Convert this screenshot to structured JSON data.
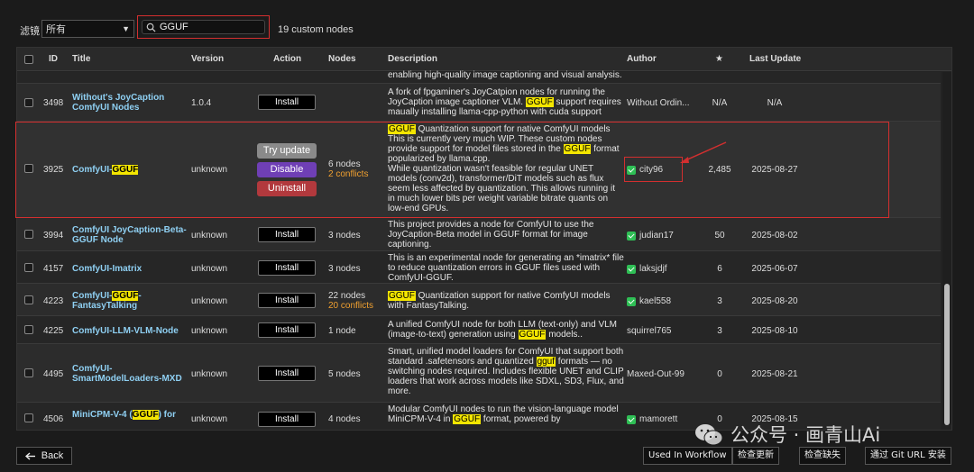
{
  "filter": {
    "label": "滤镜",
    "selected": "所有"
  },
  "search": {
    "value": "GGUF"
  },
  "count_text": "19 custom nodes",
  "columns": {
    "id": "ID",
    "title": "Title",
    "version": "Version",
    "action": "Action",
    "nodes": "Nodes",
    "description": "Description",
    "author": "Author",
    "stars": "★",
    "last_update": "Last Update"
  },
  "partial_top_desc": "enabling high-quality image captioning and visual analysis.",
  "rows": [
    {
      "id": "3498",
      "title": "Without's JoyCaption ComfyUI Nodes",
      "version": "1.0.4",
      "action": "Install",
      "desc_a": "A fork of fpgaminer's JoyCatpion nodes for running the JoyCaption image captioner VLM. ",
      "desc_hl": "GGUF",
      "desc_b": " support requires maually installing llama-cpp-python with cuda support",
      "author": "Without Ordin...",
      "stars": "N/A",
      "update": "N/A"
    },
    {
      "id": "3925",
      "title_a": "ComfyUI-",
      "title_hl": "GGUF",
      "version": "unknown",
      "actions": {
        "try_update": "Try update",
        "disable": "Disable",
        "uninstall": "Uninstall"
      },
      "nodes": "6 nodes",
      "conflicts": "2 conflicts",
      "desc_hl1": "GGUF",
      "desc_a": " Quantization support for native ComfyUI models This is currently very much WIP. These custom nodes provide support for model files stored in the ",
      "desc_hl2": "GGUF",
      "desc_b": " format popularized by llama.cpp.",
      "desc_c": "While quantization wasn't feasible for regular UNET models (conv2d), transformer/DiT models such as flux seem less affected by quantization. This allows running it in much lower bits per weight variable bitrate quants on low-end GPUs.",
      "author": "city96",
      "stars": "2,485",
      "update": "2025-08-27"
    },
    {
      "id": "3994",
      "title": "ComfyUI JoyCaption-Beta-GGUF Node",
      "version": "unknown",
      "action": "Install",
      "nodes": "3 nodes",
      "desc": "This project provides a node for ComfyUI to use the JoyCaption-Beta model in GGUF format for image captioning.",
      "author": "judian17",
      "stars": "50",
      "update": "2025-08-02"
    },
    {
      "id": "4157",
      "title": "ComfyUI-Imatrix",
      "version": "unknown",
      "action": "Install",
      "nodes": "3 nodes",
      "desc": "This is an experimental node for generating an *imatrix* file to reduce quantization errors in GGUF files used with ComfyUI-GGUF.",
      "author": "laksjdjf",
      "stars": "6",
      "update": "2025-06-07"
    },
    {
      "id": "4223",
      "title_a": "ComfyUI-",
      "title_hl": "GGUF",
      "title_b": "-FantasyTalking",
      "version": "unknown",
      "action": "Install",
      "nodes": "22 nodes",
      "conflicts": "20 conflicts",
      "desc_hl": "GGUF",
      "desc_b": " Quantization support for native ComfyUI models with FantasyTalking.",
      "author": "kael558",
      "stars": "3",
      "update": "2025-08-20"
    },
    {
      "id": "4225",
      "title": "ComfyUI-LLM-VLM-Node",
      "version": "unknown",
      "action": "Install",
      "nodes": "1 node",
      "desc_a": "A unified ComfyUI node for both LLM (text-only) and VLM (image-to-text) generation using ",
      "desc_hl": "GGUF",
      "desc_b": " models..",
      "author": "squirrel765",
      "stars": "3",
      "update": "2025-08-10"
    },
    {
      "id": "4495",
      "title": "ComfyUI-SmartModelLoaders-MXD",
      "version": "unknown",
      "action": "Install",
      "nodes": "5 nodes",
      "desc_a": "Smart, unified model loaders for ComfyUI that support both standard .safetensors and quantized ",
      "desc_hl": "gguf",
      "desc_b": " formats — no switching nodes required. Includes flexible UNET and CLIP loaders that work across models like SDXL, SD3, Flux, and more.",
      "author": "Maxed-Out-99",
      "stars": "0",
      "update": "2025-08-21"
    },
    {
      "id": "4506",
      "title_a": "MiniCPM-V-4 (",
      "title_hl": "GGUF",
      "title_b": ") for",
      "version": "unknown",
      "action": "Install",
      "nodes": "4 nodes",
      "desc_a": "Modular ComfyUI nodes to run the vision-language model MiniCPM-V-4 in ",
      "desc_hl": "GGUF",
      "desc_b": " format, powered by",
      "author": "mamorett",
      "stars": "0",
      "update": "2025-08-15"
    }
  ],
  "footer": {
    "back": "Back",
    "used_in_workflow": "Used In Workflow",
    "check_update": "检查更新",
    "check_missing": "检查缺失",
    "install_git": "通过 Git URL 安装"
  },
  "watermark": "公众号 · 画青山Ai",
  "colors": {
    "highlight": "#f4e600",
    "title": "#8fd0f3",
    "conflict": "#f0a030",
    "disable": "#6f3fb5",
    "uninstall": "#b2393d",
    "outline": "#d32f2f"
  }
}
